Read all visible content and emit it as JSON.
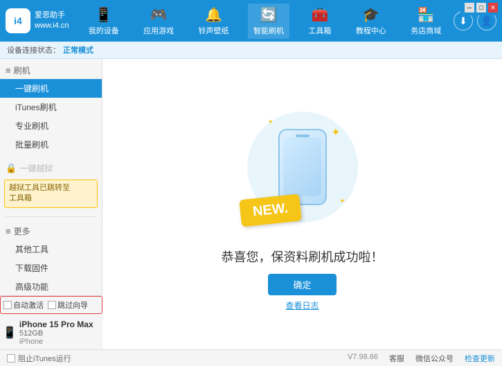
{
  "app": {
    "title": "爱思助手",
    "subtitle": "www.i4.cn"
  },
  "window_controls": {
    "minimize": "─",
    "maximize": "□",
    "close": "✕"
  },
  "nav": {
    "items": [
      {
        "id": "my-device",
        "icon": "📱",
        "label": "我的设备"
      },
      {
        "id": "apps-games",
        "icon": "🎮",
        "label": "应用游戏"
      },
      {
        "id": "ringtones",
        "icon": "🔔",
        "label": "铃声壁纸"
      },
      {
        "id": "smart-flash",
        "icon": "🔄",
        "label": "智能刷机"
      },
      {
        "id": "toolbox",
        "icon": "🧰",
        "label": "工具箱"
      },
      {
        "id": "tutorial",
        "icon": "🎓",
        "label": "教程中心"
      },
      {
        "id": "service",
        "icon": "🏪",
        "label": "务店商域"
      }
    ]
  },
  "breadcrumb": {
    "prefix": "设备连接状态：",
    "status": "正常模式"
  },
  "sidebar": {
    "flash_section": "刷机",
    "items": [
      {
        "id": "onekey-flash",
        "label": "一键刷机",
        "active": true
      },
      {
        "id": "itunes-flash",
        "label": "iTunes刷机"
      },
      {
        "id": "pro-flash",
        "label": "专业刷机"
      },
      {
        "id": "batch-flash",
        "label": "批量刷机"
      }
    ],
    "onekey_status": {
      "label": "一键越狱",
      "disabled": true,
      "notice": "越狱工具已跳转至\n工具箱"
    },
    "more_section": "更多",
    "more_items": [
      {
        "id": "other-tools",
        "label": "其他工具"
      },
      {
        "id": "download-firmware",
        "label": "下载固件"
      },
      {
        "id": "advanced",
        "label": "高级功能"
      }
    ],
    "auto_activate": "自动激活",
    "guide_activate": "跳过向导",
    "device": {
      "name": "iPhone 15 Pro Max",
      "storage": "512GB",
      "type": "iPhone"
    }
  },
  "content": {
    "new_badge": "NEW.",
    "success_text": "恭喜您，保资料刷机成功啦！",
    "confirm_button": "确定",
    "log_link": "查看日志"
  },
  "footer": {
    "itunes_label": "阻止iTunes运行",
    "version": "V7.98.66",
    "desktop": "客服",
    "wechat": "微信公众号",
    "refresh": "检查更新"
  }
}
